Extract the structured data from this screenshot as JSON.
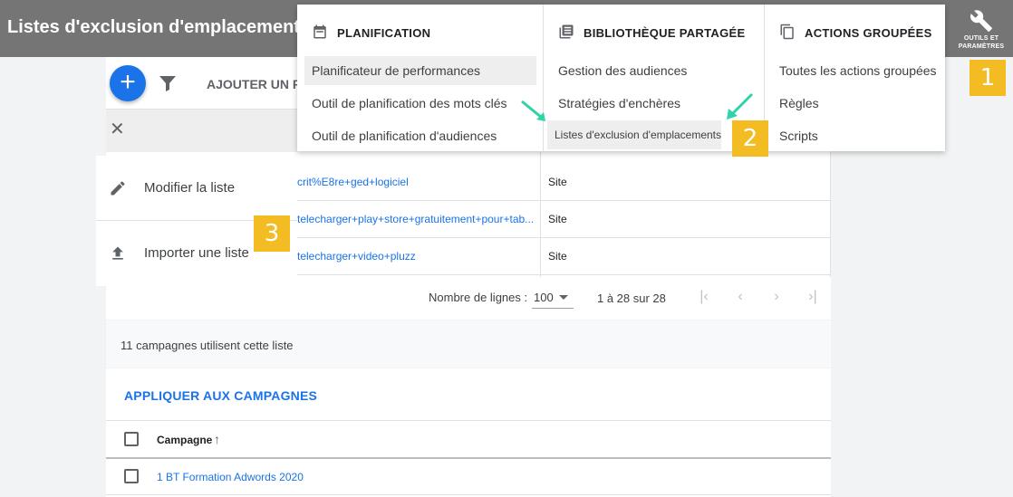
{
  "header": {
    "title": "Listes d'exclusion d'emplacements",
    "tools_label_line1": "OUTILS ET",
    "tools_label_line2": "PARAMÈTRES"
  },
  "callouts": [
    "1",
    "2",
    "3"
  ],
  "toolbar": {
    "fab_label": "+",
    "add_filter": "AJOUTER UN FI"
  },
  "actions": [
    {
      "label": "Modifier la liste",
      "icon": "pencil-icon"
    },
    {
      "label": "Importer une liste",
      "icon": "upload-icon"
    }
  ],
  "table": {
    "rows": [
      {
        "link": "crit%E8re+ged+logiciel",
        "type": "Site"
      },
      {
        "link": "telecharger+play+store+gratuitement+pour+tab...",
        "type": "Site"
      },
      {
        "link": "telecharger+video+pluzz",
        "type": "Site"
      }
    ]
  },
  "pagination": {
    "rows_label": "Nombre de lignes :",
    "rows_value": "100",
    "range": "1 à 28 sur 28"
  },
  "campaigns": {
    "info": "11 campagnes utilisent cette liste",
    "apply": "APPLIQUER AUX CAMPAGNES",
    "column": "Campagne",
    "rows": [
      "1 BT Formation Adwords 2020"
    ]
  },
  "menu": {
    "columns": [
      {
        "heading": "PLANIFICATION",
        "icon": "calendar-icon",
        "items": [
          "Planificateur de performances",
          "Outil de planification des mots clés",
          "Outil de planification d'audiences"
        ]
      },
      {
        "heading": "BIBLIOTHÈQUE PARTAGÉE",
        "icon": "library-icon",
        "items": [
          "Gestion des audiences",
          "Stratégies d'enchères",
          "Listes d'exclusion d'emplacements"
        ]
      },
      {
        "heading": "ACTIONS GROUPÉES",
        "icon": "copy-icon",
        "items": [
          "Toutes les actions groupées",
          "Règles",
          "Scripts"
        ]
      }
    ]
  },
  "colors": {
    "header": "#757575",
    "accent": "#1a73e8",
    "callout": "#f4bc23",
    "arrow": "#2ed4a8"
  }
}
